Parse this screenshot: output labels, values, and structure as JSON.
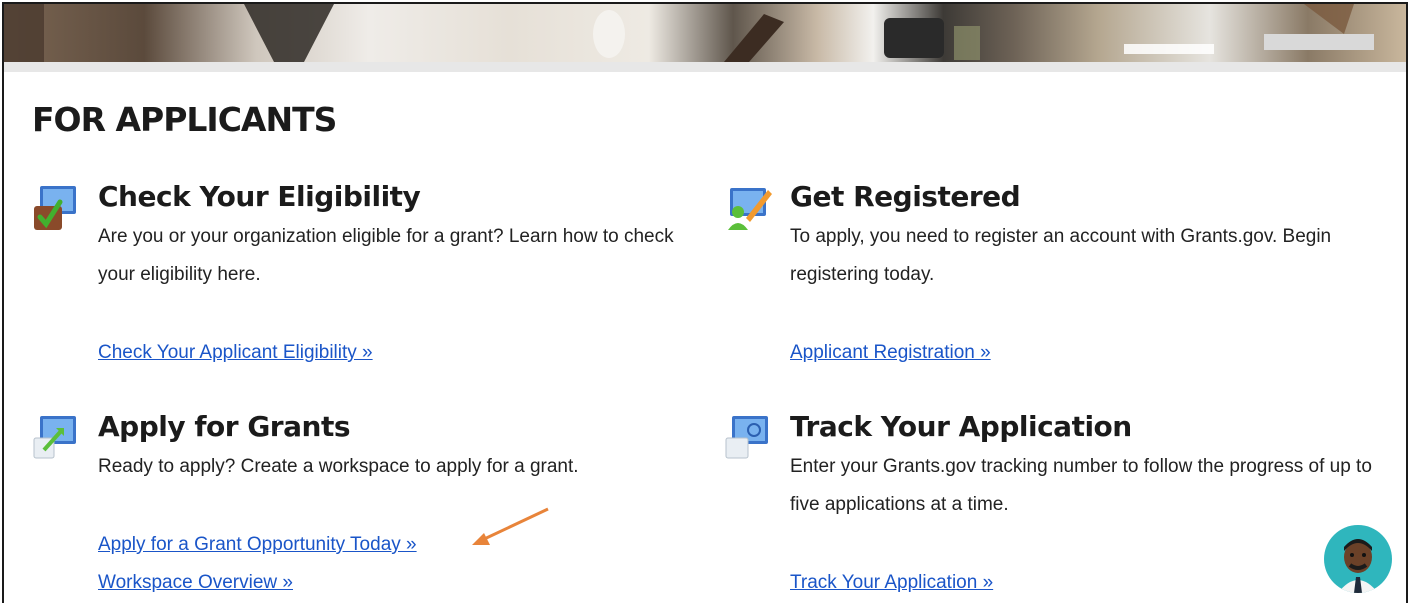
{
  "section_title": "FOR APPLICANTS",
  "cards": {
    "eligibility": {
      "title": "Check Your Eligibility",
      "description": "Are you or your organization eligible for a grant? Learn how to check your eligibility here.",
      "links": [
        "Check Your Applicant Eligibility »"
      ],
      "icon": "monitor-checkmark-icon"
    },
    "register": {
      "title": "Get Registered",
      "description": "To apply, you need to register an account with Grants.gov. Begin registering today.",
      "links": [
        "Applicant Registration »"
      ],
      "icon": "monitor-pencil-user-icon"
    },
    "apply": {
      "title": "Apply for Grants",
      "description": "Ready to apply? Create a workspace to apply for a grant.",
      "links": [
        "Apply for a Grant Opportunity Today »",
        "Workspace Overview »"
      ],
      "icon": "monitor-arrow-icon"
    },
    "track": {
      "title": "Track Your Application",
      "description": "Enter your Grants.gov tracking number to follow the progress of up to five applications at a time.",
      "links": [
        "Track Your Application »"
      ],
      "icon": "monitor-magnifier-icon"
    }
  },
  "colors": {
    "link": "#1a55c8",
    "heading": "#1b1b1b",
    "annotation_arrow": "#e8843a",
    "chat_bubble": "#2fb6bd"
  }
}
